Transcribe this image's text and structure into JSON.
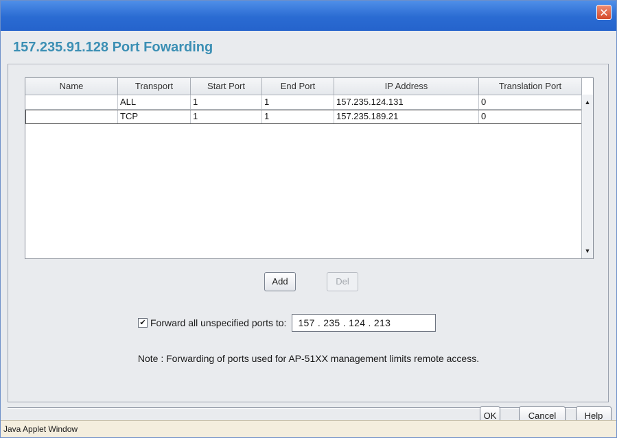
{
  "window": {
    "close_glyph": "✕"
  },
  "header": {
    "title": "157.235.91.128 Port Fowarding"
  },
  "table": {
    "columns": [
      "Name",
      "Transport",
      "Start Port",
      "End Port",
      "IP Address",
      "Translation Port"
    ],
    "rows": [
      [
        "",
        "ALL",
        "1",
        "1",
        "157.235.124.131",
        "0"
      ],
      [
        "",
        "TCP",
        "1",
        "1",
        "157.235.189.21",
        "0"
      ]
    ]
  },
  "scrollbar": {
    "up_glyph": "▲",
    "down_glyph": "▼"
  },
  "actions": {
    "add_label": "Add",
    "del_label": "Del"
  },
  "forward": {
    "checked": true,
    "check_glyph": "✔",
    "label": "Forward all unspecified ports to:",
    "ip_value": "157 . 235 . 124 . 213"
  },
  "note": "Note : Forwarding of ports used for AP-51XX management limits remote access.",
  "footer": {
    "ok_label": "OK",
    "cancel_label": "Cancel",
    "help_label": "Help"
  },
  "status": {
    "text": "Java Applet Window"
  },
  "colors": {
    "title": "#3b8fb4",
    "titlebar": "#2a6bd2",
    "close": "#d44a2a",
    "statusbar": "#f4eede"
  }
}
